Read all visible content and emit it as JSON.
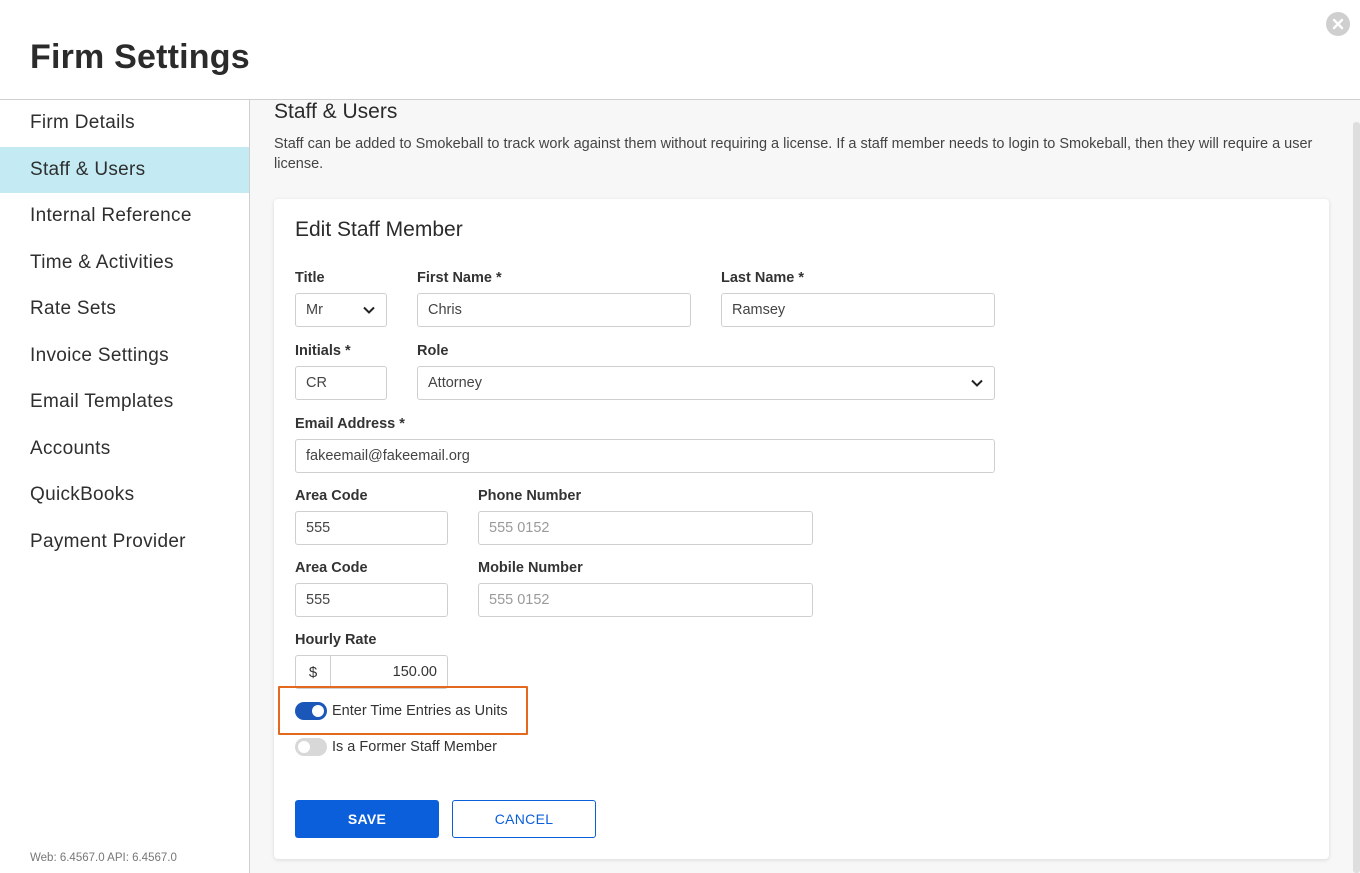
{
  "header": {
    "title": "Firm Settings"
  },
  "sidebar": {
    "items": [
      {
        "label": "Firm Details"
      },
      {
        "label": "Staff & Users"
      },
      {
        "label": "Internal Reference"
      },
      {
        "label": "Time & Activities"
      },
      {
        "label": "Rate Sets"
      },
      {
        "label": "Invoice Settings"
      },
      {
        "label": "Email Templates"
      },
      {
        "label": "Accounts"
      },
      {
        "label": "QuickBooks"
      },
      {
        "label": "Payment Provider"
      }
    ],
    "active_index": 1,
    "version": "Web: 6.4567.0 API: 6.4567.0"
  },
  "section": {
    "title": "Staff & Users",
    "description": "Staff can be added to Smokeball to track work against them without requiring a license. If a staff member needs to login to Smokeball, then they will require a user license."
  },
  "form": {
    "title": "Edit Staff Member",
    "title_label": "Title",
    "title_value": "Mr",
    "first_name_label": "First Name *",
    "first_name_value": "Chris",
    "last_name_label": "Last Name *",
    "last_name_value": "Ramsey",
    "initials_label": "Initials *",
    "initials_value": "CR",
    "role_label": "Role",
    "role_value": "Attorney",
    "email_label": "Email Address *",
    "email_value": "fakeemail@fakeemail.org",
    "phone_area_label": "Area Code",
    "phone_area_value": "555",
    "phone_label": "Phone Number",
    "phone_placeholder": "555 0152",
    "mobile_area_label": "Area Code",
    "mobile_area_value": "555",
    "mobile_label": "Mobile Number",
    "mobile_placeholder": "555 0152",
    "rate_label": "Hourly Rate",
    "currency_symbol": "$",
    "rate_value": "150.00",
    "toggle_units_label": "Enter Time Entries as Units",
    "toggle_units_on": true,
    "toggle_former_label": "Is a Former Staff Member",
    "toggle_former_on": false,
    "save_label": "SAVE",
    "cancel_label": "CANCEL"
  },
  "colors": {
    "accent": "#0b5fdb",
    "active_nav": "#c4ebf4",
    "toggle_on": "#1a57b8",
    "highlight": "#e2691d"
  }
}
